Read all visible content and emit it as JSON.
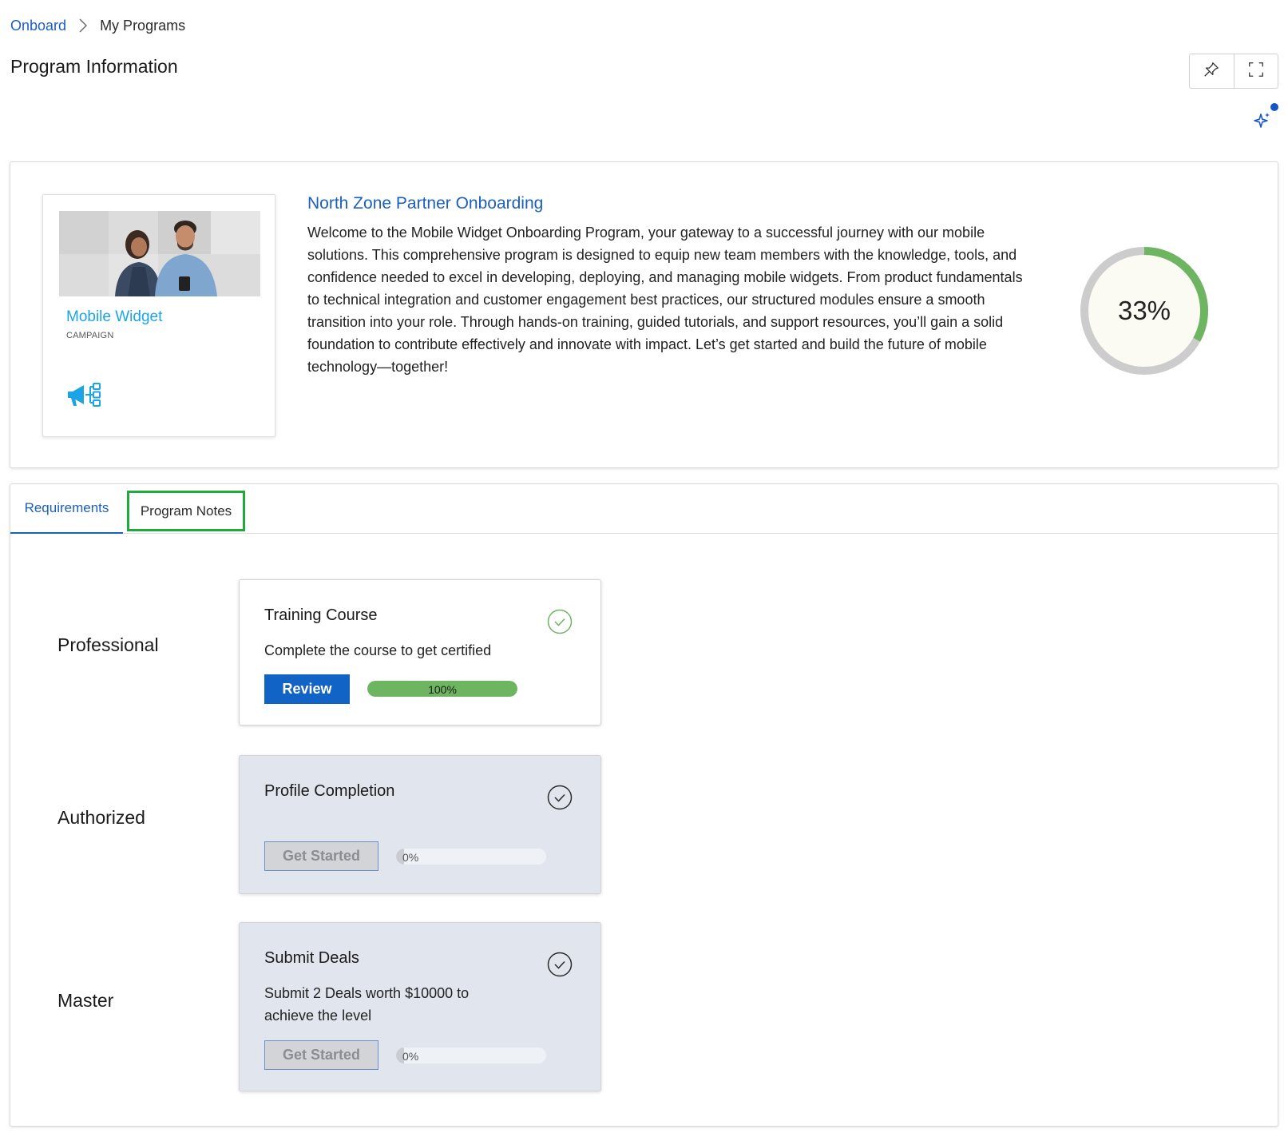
{
  "breadcrumb": {
    "root": "Onboard",
    "current": "My Programs"
  },
  "page": {
    "title": "Program Information"
  },
  "toolbar": {
    "pin_icon": "pin-icon",
    "fullscreen_icon": "fullscreen-icon",
    "ai_icon": "sparkle-icon"
  },
  "program": {
    "tile_title": "Mobile Widget",
    "tile_subtitle": "CAMPAIGN",
    "tile_icon": "campaign-megaphone-icon",
    "title": "North Zone Partner Onboarding",
    "description": "Welcome to the Mobile Widget Onboarding Program, your gateway to a successful journey with our mobile solutions. This comprehensive program is designed to equip new team members with the knowledge, tools, and confidence needed to excel in developing, deploying, and managing mobile widgets. From product fundamentals to technical integration and customer engagement best practices, our structured modules ensure a smooth transition into your role. Through hands-on training, guided tutorials, and support resources, you’ll gain a solid foundation to contribute effectively and innovate with impact. Let’s get started and build the future of mobile technology—together!",
    "progress_label": "33%",
    "progress_fraction": 0.33
  },
  "tabs": [
    {
      "label": "Requirements",
      "active": true
    },
    {
      "label": "Program Notes",
      "active": false
    }
  ],
  "levels": [
    {
      "label": "Professional",
      "requirement": {
        "title": "Training Course",
        "description": "Complete the course to get certified",
        "button": "Review",
        "progress_label": "100%",
        "progress_fraction": 1.0,
        "completed": true
      }
    },
    {
      "label": "Authorized",
      "requirement": {
        "title": "Profile Completion",
        "description": "",
        "button": "Get Started",
        "progress_label": "0%",
        "progress_fraction": 0.0,
        "completed": false
      }
    },
    {
      "label": "Master",
      "requirement": {
        "title": "Submit Deals",
        "description": "Submit 2 Deals worth $10000 to achieve the level",
        "button": "Get Started",
        "progress_label": "0%",
        "progress_fraction": 0.0,
        "completed": false
      }
    }
  ],
  "colors": {
    "link": "#1b5fbf",
    "progress_green": "#6db560",
    "ring_track": "#cccccc",
    "tile_title": "#1ba4e6",
    "primary_button": "#1263c6",
    "tab_highlight": "#1faa3c"
  }
}
